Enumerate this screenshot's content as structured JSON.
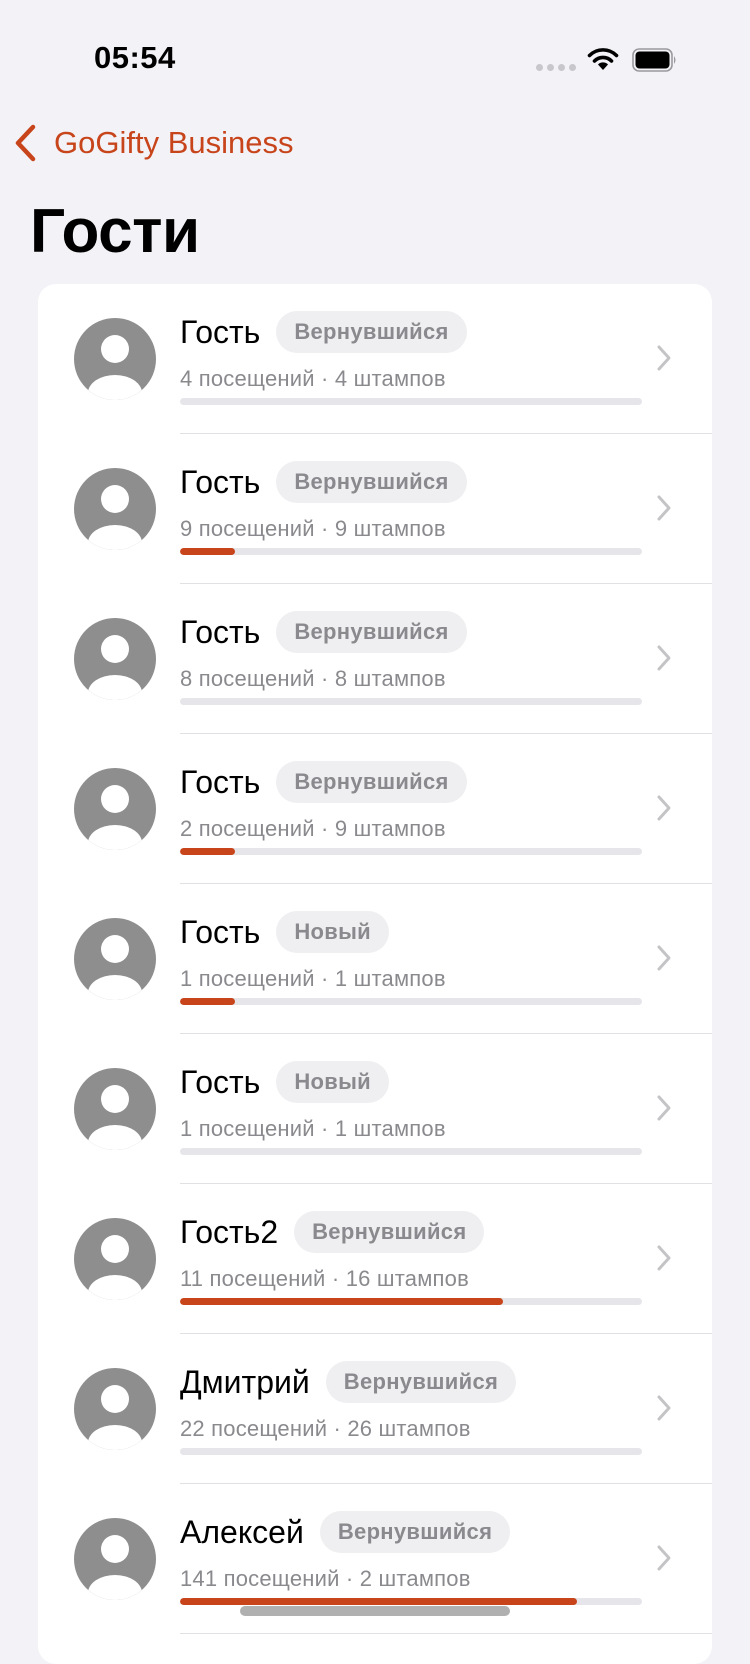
{
  "status_bar": {
    "time": "05:54",
    "icons": [
      "signal-dots-icon",
      "wifi-icon",
      "battery-icon"
    ]
  },
  "nav": {
    "back_label": "GoGifty Business",
    "back_icon": "chevron-left-icon"
  },
  "page": {
    "title": "Гости"
  },
  "colors": {
    "accent": "#c8451b",
    "background": "#f2f2f7",
    "card": "#ffffff",
    "badge_bg": "#efeff1",
    "secondary_text": "#8a8a8e",
    "avatar": "#8e8e8e",
    "track": "#e6e6ea"
  },
  "guests": [
    {
      "name": "Гость",
      "badge": "Вернувшийся",
      "subtitle": "4 посещений · 4 штампов",
      "progress": 0
    },
    {
      "name": "Гость",
      "badge": "Вернувшийся",
      "subtitle": "9 посещений · 9 штампов",
      "progress": 0.12
    },
    {
      "name": "Гость",
      "badge": "Вернувшийся",
      "subtitle": "8 посещений · 8 штампов",
      "progress": 0
    },
    {
      "name": "Гость",
      "badge": "Вернувшийся",
      "subtitle": "2 посещений · 9 штампов",
      "progress": 0.12
    },
    {
      "name": "Гость",
      "badge": "Новый",
      "subtitle": "1 посещений · 1 штампов",
      "progress": 0.12
    },
    {
      "name": "Гость",
      "badge": "Новый",
      "subtitle": "1 посещений · 1 штампов",
      "progress": 0
    },
    {
      "name": "Гость2",
      "badge": "Вернувшийся",
      "subtitle": "11 посещений · 16 штампов",
      "progress": 0.7
    },
    {
      "name": "Дмитрий",
      "badge": "Вернувшийся",
      "subtitle": "22 посещений · 26 штампов",
      "progress": 0
    },
    {
      "name": "Алексей",
      "badge": "Вернувшийся",
      "subtitle": "141 посещений · 2 штампов",
      "progress": 0.86
    }
  ]
}
